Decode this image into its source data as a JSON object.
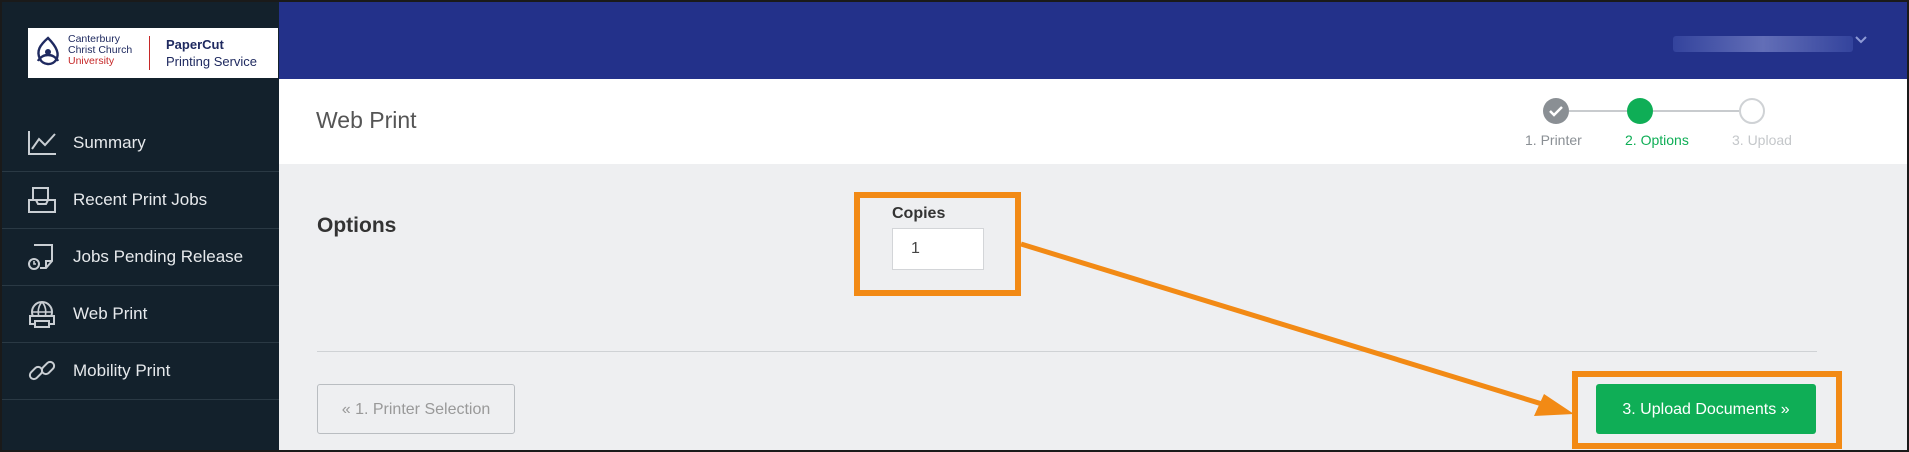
{
  "logo": {
    "university_line1": "Canterbury",
    "university_line2": "Christ Church",
    "university_line3": "University",
    "product_line1": "PaperCut",
    "product_line2": "Printing Service"
  },
  "sidebar": {
    "items": [
      {
        "label": "Summary",
        "icon": "chart-line-icon"
      },
      {
        "label": "Recent Print Jobs",
        "icon": "inbox-tray-icon"
      },
      {
        "label": "Jobs Pending Release",
        "icon": "pending-document-icon"
      },
      {
        "label": "Web Print",
        "icon": "globe-printer-icon"
      },
      {
        "label": "Mobility Print",
        "icon": "link-chain-icon"
      }
    ]
  },
  "header": {
    "page_title": "Web Print",
    "steps": [
      {
        "label": "1. Printer",
        "state": "done"
      },
      {
        "label": "2. Options",
        "state": "active"
      },
      {
        "label": "3. Upload",
        "state": "pending"
      }
    ]
  },
  "options": {
    "section_title": "Options",
    "copies_label": "Copies",
    "copies_value": "1"
  },
  "buttons": {
    "back_label": "« 1. Printer Selection",
    "upload_label": "3. Upload Documents »"
  },
  "colors": {
    "topbar": "#23318a",
    "sidebar": "#13212c",
    "accent_green": "#0fae56",
    "annotation_orange": "#f28a15",
    "step_done": "#8a8f94"
  }
}
